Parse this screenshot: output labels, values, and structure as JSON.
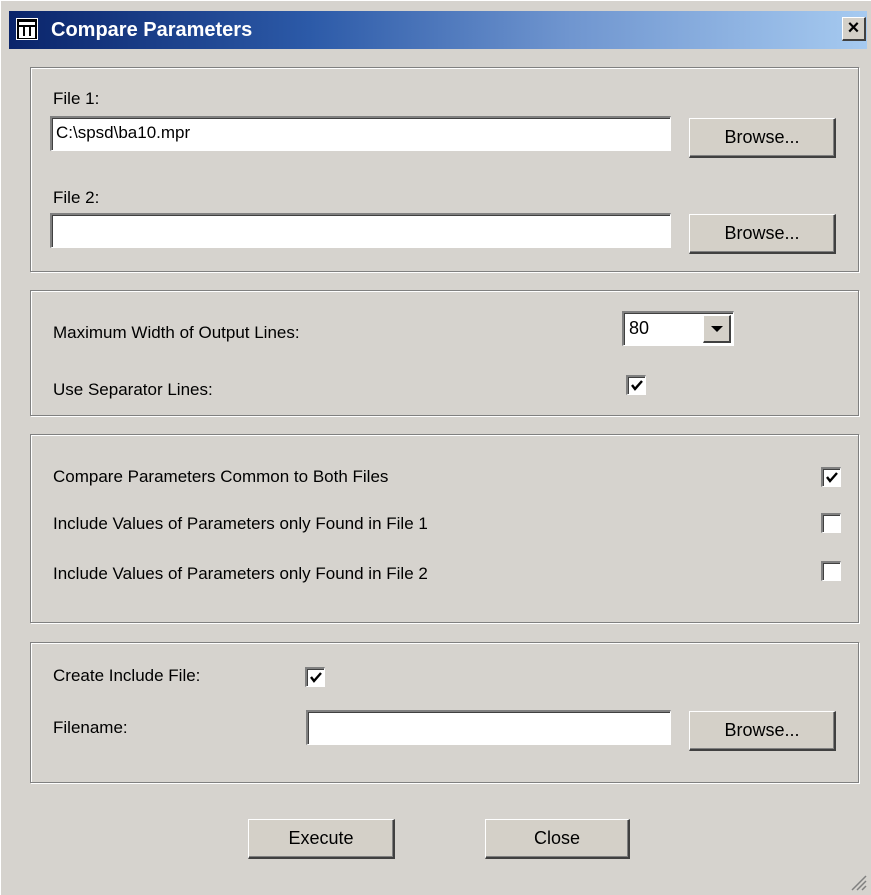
{
  "window": {
    "title": "Compare Parameters",
    "close_glyph": "×",
    "icon": "app-window-icon"
  },
  "files": {
    "file1_label": "File 1:",
    "file1_value": "C:\\spsd\\ba10.mpr",
    "file2_label": "File 2:",
    "file2_value": "",
    "browse_label": "Browse..."
  },
  "output": {
    "max_width_label": "Maximum Width of Output Lines:",
    "max_width_value": "80",
    "separator_label": "Use Separator Lines:",
    "separator_checked": true
  },
  "compare": {
    "common_label": "Compare Parameters Common to Both Files",
    "common_checked": true,
    "only1_label": "Include Values of Parameters only Found in File 1",
    "only1_checked": false,
    "only2_label": "Include Values of Parameters only Found in File 2",
    "only2_checked": false
  },
  "include": {
    "create_label": "Create Include File:",
    "create_checked": true,
    "filename_label": "Filename:",
    "filename_value": "",
    "browse_label": "Browse..."
  },
  "actions": {
    "execute_label": "Execute",
    "close_label": "Close"
  }
}
